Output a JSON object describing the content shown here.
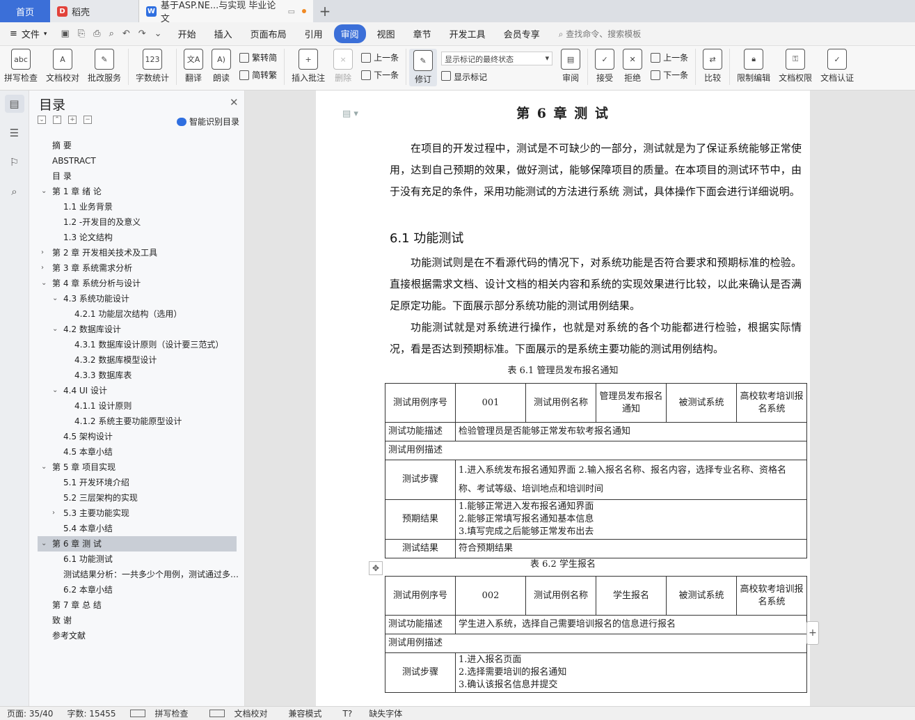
{
  "tabs": {
    "home": "首页",
    "t1": "稻壳",
    "t2": "基于ASP.NE...与实现 毕业论文"
  },
  "menu": {
    "file": "文件",
    "tabs": [
      "开始",
      "插入",
      "页面布局",
      "引用",
      "审阅",
      "视图",
      "章节",
      "开发工具",
      "会员专享"
    ],
    "active": "审阅",
    "search": "查找命令、搜索模板"
  },
  "ribbon": {
    "spell": "拼写检查",
    "proof": "文档校对",
    "batch": "批改服务",
    "wordcount": "字数统计",
    "translate": "翻译",
    "read": "朗读",
    "to_trad": "繁转简",
    "to_simp": "简转繁",
    "insert_comment": "插入批注",
    "delete": "删除",
    "prev_comment": "上一条",
    "next_comment": "下一条",
    "revise": "修订",
    "markup_state": "显示标记的最终状态",
    "show_markup": "显示标记",
    "review": "审阅",
    "accept": "接受",
    "reject": "拒绝",
    "prev_change": "上一条",
    "next_change": "下一条",
    "compare": "比较",
    "restrict": "限制编辑",
    "permission": "文档权限",
    "certify": "文档认证"
  },
  "toc": {
    "title": "目录",
    "smart": "智能识别目录",
    "items": [
      {
        "text": "摘  要",
        "level": 0,
        "arrow": ""
      },
      {
        "text": "ABSTRACT",
        "level": 0,
        "arrow": ""
      },
      {
        "text": "目  录",
        "level": 0,
        "arrow": ""
      },
      {
        "text": "第 1 章  绪  论",
        "level": 0,
        "arrow": "v"
      },
      {
        "text": "1.1  业务背景",
        "level": 1,
        "arrow": ""
      },
      {
        "text": "1.2 -开发目的及意义",
        "level": 1,
        "arrow": ""
      },
      {
        "text": "1.3  论文结构",
        "level": 1,
        "arrow": ""
      },
      {
        "text": "第 2 章  开发相关技术及工具",
        "level": 0,
        "arrow": ">"
      },
      {
        "text": "第 3 章  系统需求分析",
        "level": 0,
        "arrow": ">"
      },
      {
        "text": "第 4 章  系统分析与设计",
        "level": 0,
        "arrow": "v"
      },
      {
        "text": "4.3  系统功能设计",
        "level": 1,
        "arrow": "v"
      },
      {
        "text": "4.2.1  功能层次结构（选用）",
        "level": 2,
        "arrow": ""
      },
      {
        "text": "4.2  数据库设计",
        "level": 1,
        "arrow": "v"
      },
      {
        "text": "4.3.1  数据库设计原则（设计要三范式）",
        "level": 2,
        "arrow": ""
      },
      {
        "text": "4.3.2  数据库模型设计",
        "level": 2,
        "arrow": ""
      },
      {
        "text": "4.3.3  数据库表",
        "level": 2,
        "arrow": ""
      },
      {
        "text": "4.4 UI 设计",
        "level": 1,
        "arrow": "v"
      },
      {
        "text": "4.1.1  设计原则",
        "level": 2,
        "arrow": ""
      },
      {
        "text": "4.1.2  系统主要功能原型设计",
        "level": 2,
        "arrow": ""
      },
      {
        "text": "4.5  架构设计",
        "level": 1,
        "arrow": ""
      },
      {
        "text": "4.5  本章小结",
        "level": 1,
        "arrow": ""
      },
      {
        "text": "第 5 章  项目实现",
        "level": 0,
        "arrow": "v"
      },
      {
        "text": "5.1  开发环境介绍",
        "level": 1,
        "arrow": ""
      },
      {
        "text": "5.2  三层架构的实现",
        "level": 1,
        "arrow": ""
      },
      {
        "text": "5.3  主要功能实现",
        "level": 1,
        "arrow": ">"
      },
      {
        "text": "5.4  本章小结",
        "level": 1,
        "arrow": ""
      },
      {
        "text": "第 6 章  测  试",
        "level": 0,
        "arrow": "v",
        "selected": true
      },
      {
        "text": "6.1  功能测试",
        "level": 1,
        "arrow": ""
      },
      {
        "text": "测试结果分析：一共多少个用例，测试通过多少个…",
        "level": 1,
        "arrow": ""
      },
      {
        "text": "6.2 本章小结",
        "level": 1,
        "arrow": ""
      },
      {
        "text": "第 7 章  总  结",
        "level": 0,
        "arrow": ""
      },
      {
        "text": "致  谢",
        "level": 0,
        "arrow": ""
      },
      {
        "text": "参考文献",
        "level": 0,
        "arrow": ""
      }
    ]
  },
  "doc": {
    "chapter_title": "第 6 章  测  试",
    "p1": "在项目的开发过程中，测试是不可缺少的一部分，测试就是为了保证系统能够正常使用，达到自己预期的效果，做好测试，能够保障项目的质量。在本项目的测试环节中，由于没有充足的条件，采用功能测试的方法进行系统  测试，具体操作下面会进行详细说明。",
    "h2": "6.1  功能测试",
    "p2": "功能测试则是在不看源代码的情况下，对系统功能是否符合要求和预期标准的检验。直接根据需求文档、设计文档的相关内容和系统的实现效果进行比较，以此来确认是否满足原定功能。下面展示部分系统功能的测试用例结果。",
    "p3": "功能测试就是对系统进行操作，也就是对系统的各个功能都进行检验，根据实际情况，看是否达到预期标准。下面展示的是系统主要功能的测试用例结构。",
    "t1_caption": "表 6.1  管理员发布报名通知",
    "t1": {
      "case_no_label": "测试用例序号",
      "case_no": "001",
      "case_name_label": "测试用例名称",
      "case_name": "管理员发布报名通知",
      "system_label": "被测试系统",
      "system": "高校软考培训报名系统",
      "func_label": "测试功能描述",
      "func": "检验管理员是否能够正常发布软考报名通知",
      "desc_label": "测试用例描述",
      "steps_label": "测试步骤",
      "steps": "1.进入系统发布报名通知界面    2.输入报名名称、报名内容，选择专业名称、资格名称、考试等级、培训地点和培训时间",
      "expect_label": "预期结果",
      "expect1": "1.能够正常进入发布报名通知界面",
      "expect2": "2.能够正常填写报名通知基本信息",
      "expect3": "3.填写完成之后能够正常发布出去",
      "result_label": "测试结果",
      "result": "符合预期结果"
    },
    "t2_caption": "表 6.2  学生报名",
    "t2": {
      "case_no_label": "测试用例序号",
      "case_no": "002",
      "case_name_label": "测试用例名称",
      "case_name": "学生报名",
      "system_label": "被测试系统",
      "system": "高校软考培训报名系统",
      "func_label": "测试功能描述",
      "func": "学生进入系统，选择自己需要培训报名的信息进行报名",
      "desc_label": "测试用例描述",
      "steps_label": "测试步骤",
      "step1": "1.进入报名页面",
      "step2": "2.选择需要培训的报名通知",
      "step3": "3.确认该报名信息并提交"
    }
  },
  "status": {
    "page": "页面: 35/40",
    "words": "字数: 15455",
    "spell": "拼写检查",
    "proof": "文档校对",
    "compat": "兼容模式",
    "missing_font": "缺失字体"
  }
}
